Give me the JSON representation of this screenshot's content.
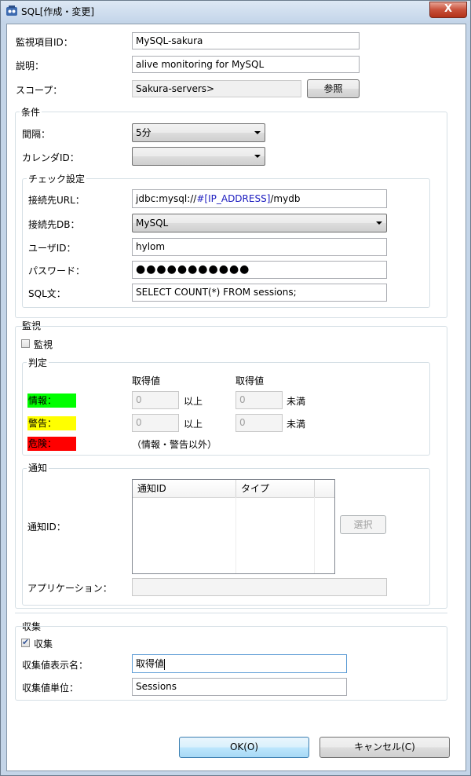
{
  "window": {
    "title": "SQL[作成・変更]",
    "close_symbol": "X"
  },
  "fields": {
    "monitor_id_label": "監視項目ID：",
    "monitor_id": "MySQL-sakura",
    "description_label": "説明：",
    "description": "alive monitoring for MySQL",
    "scope_label": "スコープ：",
    "scope": "Sakura-servers>",
    "scope_button": "参照"
  },
  "condition": {
    "group_title": "条件",
    "interval_label": "間隔：",
    "interval": "5分",
    "calendar_label": "カレンダID：",
    "calendar": ""
  },
  "check": {
    "group_title": "チェック設定",
    "url_label": "接続先URL：",
    "url_prefix": "jdbc:mysql://",
    "url_var": "#[IP_ADDRESS]",
    "url_suffix": "/mydb",
    "db_label": "接続先DB：",
    "db": "MySQL",
    "user_label": "ユーザID：",
    "user": "hylom",
    "password_label": "パスワード：",
    "password": "●●●●●●●●●●●",
    "sql_label": "SQL文：",
    "sql": "SELECT COUNT(*) FROM sessions;"
  },
  "monitor": {
    "section_title": "監視",
    "checkbox_label": "監視",
    "checked": false,
    "judge_title": "判定",
    "col1_header": "取得値",
    "col2_header": "取得値",
    "info_label": "情報：",
    "warn_label": "警告：",
    "danger_label": "危険：",
    "info_min": "0",
    "info_max": "0",
    "warn_min": "0",
    "warn_max": "0",
    "above": "以上",
    "below": "未満",
    "above2": "以上",
    "below2": "未満",
    "danger_note": "（情報・警告以外）",
    "colors": {
      "info": "#00ff00",
      "warn": "#ffff00",
      "danger": "#ff0000"
    }
  },
  "notify": {
    "group_title": "通知",
    "id_label": "通知ID：",
    "col_id": "通知ID",
    "col_type": "タイプ",
    "select_button": "選択",
    "app_label": "アプリケーション：",
    "app": ""
  },
  "collect": {
    "section_title": "収集",
    "checkbox_label": "収集",
    "checked": true,
    "display_name_label": "収集値表示名：",
    "display_name": "取得値",
    "unit_label": "収集値単位：",
    "unit": "Sessions"
  },
  "buttons": {
    "ok": "OK(O)",
    "cancel": "キャンセル(C)"
  }
}
